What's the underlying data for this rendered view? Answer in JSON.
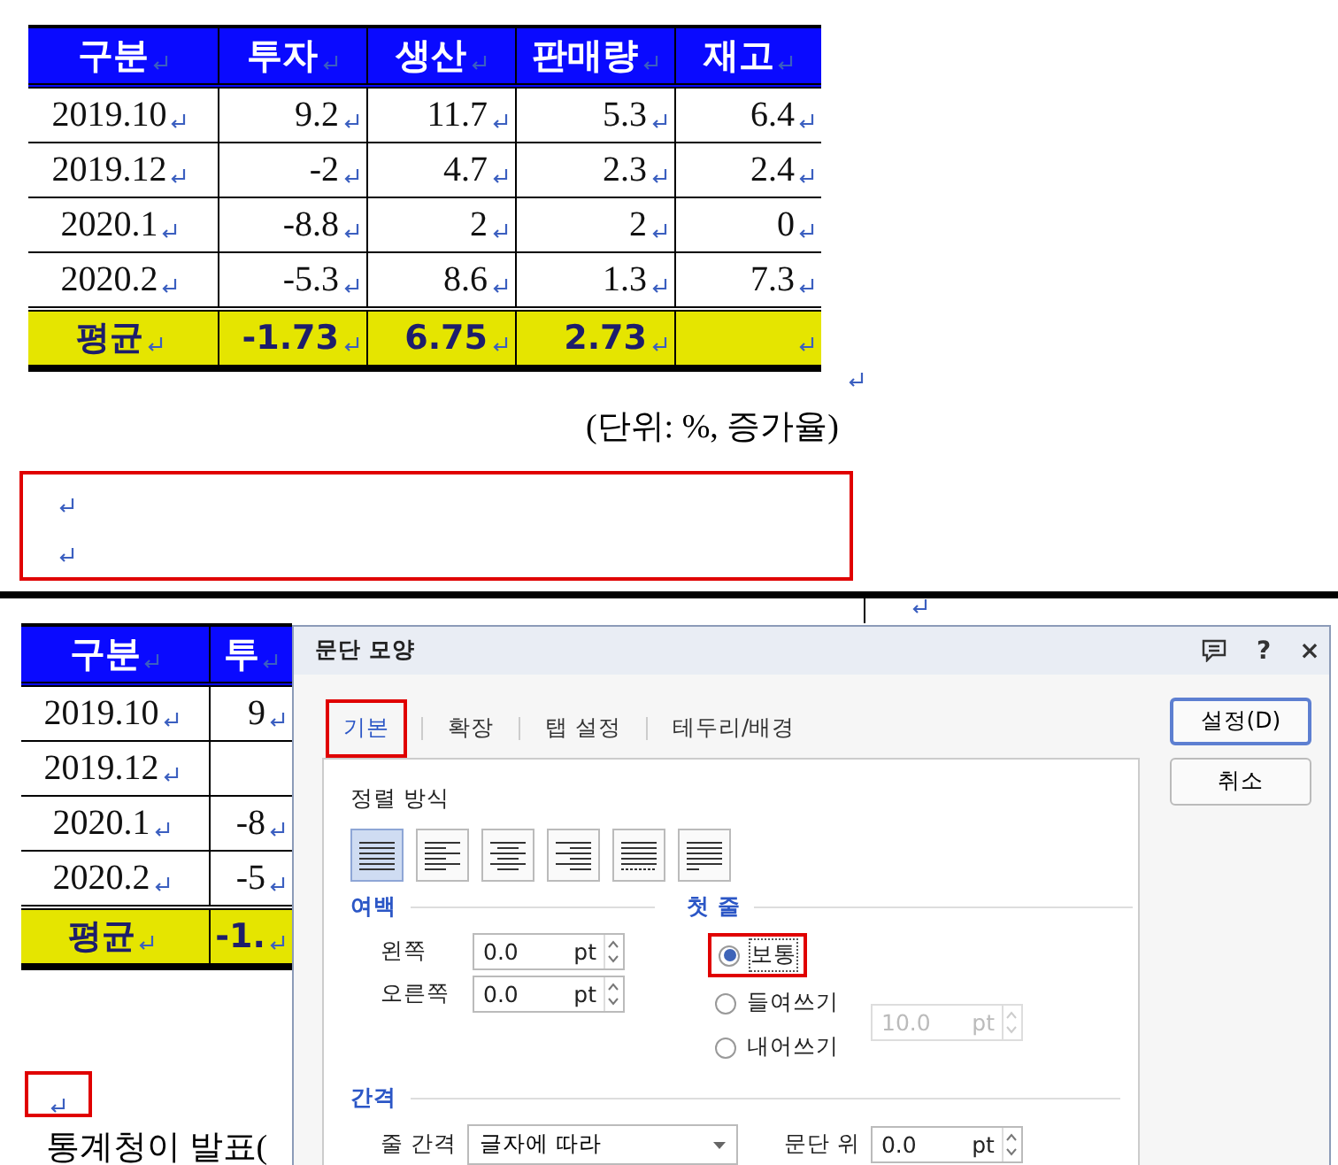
{
  "top_document": {
    "table": {
      "columns": [
        "구분",
        "투자",
        "생산",
        "판매량",
        "재고"
      ],
      "rows": [
        {
          "cells": [
            "2019.10",
            "9.2",
            "11.7",
            "5.3",
            "6.4"
          ]
        },
        {
          "cells": [
            "2019.12",
            "-2",
            "4.7",
            "2.3",
            "2.4"
          ]
        },
        {
          "cells": [
            "2020.1",
            "-8.8",
            "2",
            "2",
            "0"
          ]
        },
        {
          "cells": [
            "2020.2",
            "-5.3",
            "8.6",
            "1.3",
            "7.3"
          ]
        }
      ],
      "average_row": {
        "cells": [
          "평균",
          "-1.73",
          "6.75",
          "2.73"
        ]
      }
    },
    "caption": "(단위: %, 증가율)"
  },
  "bottom_document": {
    "table": {
      "columns": [
        "구분",
        "투"
      ],
      "rows": [
        {
          "cells": [
            "2019.10",
            "9"
          ]
        },
        {
          "cells": [
            "2019.12"
          ]
        },
        {
          "cells": [
            "2020.1",
            "-8"
          ]
        },
        {
          "cells": [
            "2020.2",
            "-5"
          ]
        }
      ],
      "average_row": {
        "cells": [
          "평균",
          "-1."
        ]
      }
    },
    "body_text": "통계청이  발표("
  },
  "dialog": {
    "title": "문단 모양",
    "help": "?",
    "close": "×",
    "tabs": [
      {
        "label": "기본",
        "selected": true
      },
      {
        "label": "확장",
        "selected": false
      },
      {
        "label": "탭 설정",
        "selected": false
      },
      {
        "label": "테두리/배경",
        "selected": false
      }
    ],
    "buttons": [
      {
        "label": "설정(D)",
        "default": true
      },
      {
        "label": "취소",
        "default": false
      }
    ],
    "alignment": {
      "label": "정렬 방식",
      "options": [
        {
          "kind": "justify",
          "selected": true
        },
        {
          "kind": "left",
          "selected": false
        },
        {
          "kind": "center",
          "selected": false
        },
        {
          "kind": "right",
          "selected": false
        },
        {
          "kind": "distribute",
          "selected": false
        },
        {
          "kind": "divide",
          "selected": false
        }
      ]
    },
    "margin": {
      "label": "여백",
      "fields": [
        {
          "label": "왼쪽",
          "value": "0.0",
          "unit": "pt"
        },
        {
          "label": "오른쪽",
          "value": "0.0",
          "unit": "pt"
        }
      ]
    },
    "first_line": {
      "label": "첫 줄",
      "options": [
        {
          "label": "보통",
          "selected": true
        },
        {
          "label": "들여쓰기",
          "selected": false
        },
        {
          "label": "내어쓰기",
          "selected": false
        }
      ],
      "field": {
        "value": "10.0",
        "unit": "pt",
        "disabled": true
      }
    },
    "spacing": {
      "label": "간격",
      "line_spacing": {
        "label": "줄 간격",
        "value": "글자에 따라"
      },
      "before": {
        "label": "문단 위",
        "value": "0.0",
        "unit": "pt"
      }
    }
  }
}
